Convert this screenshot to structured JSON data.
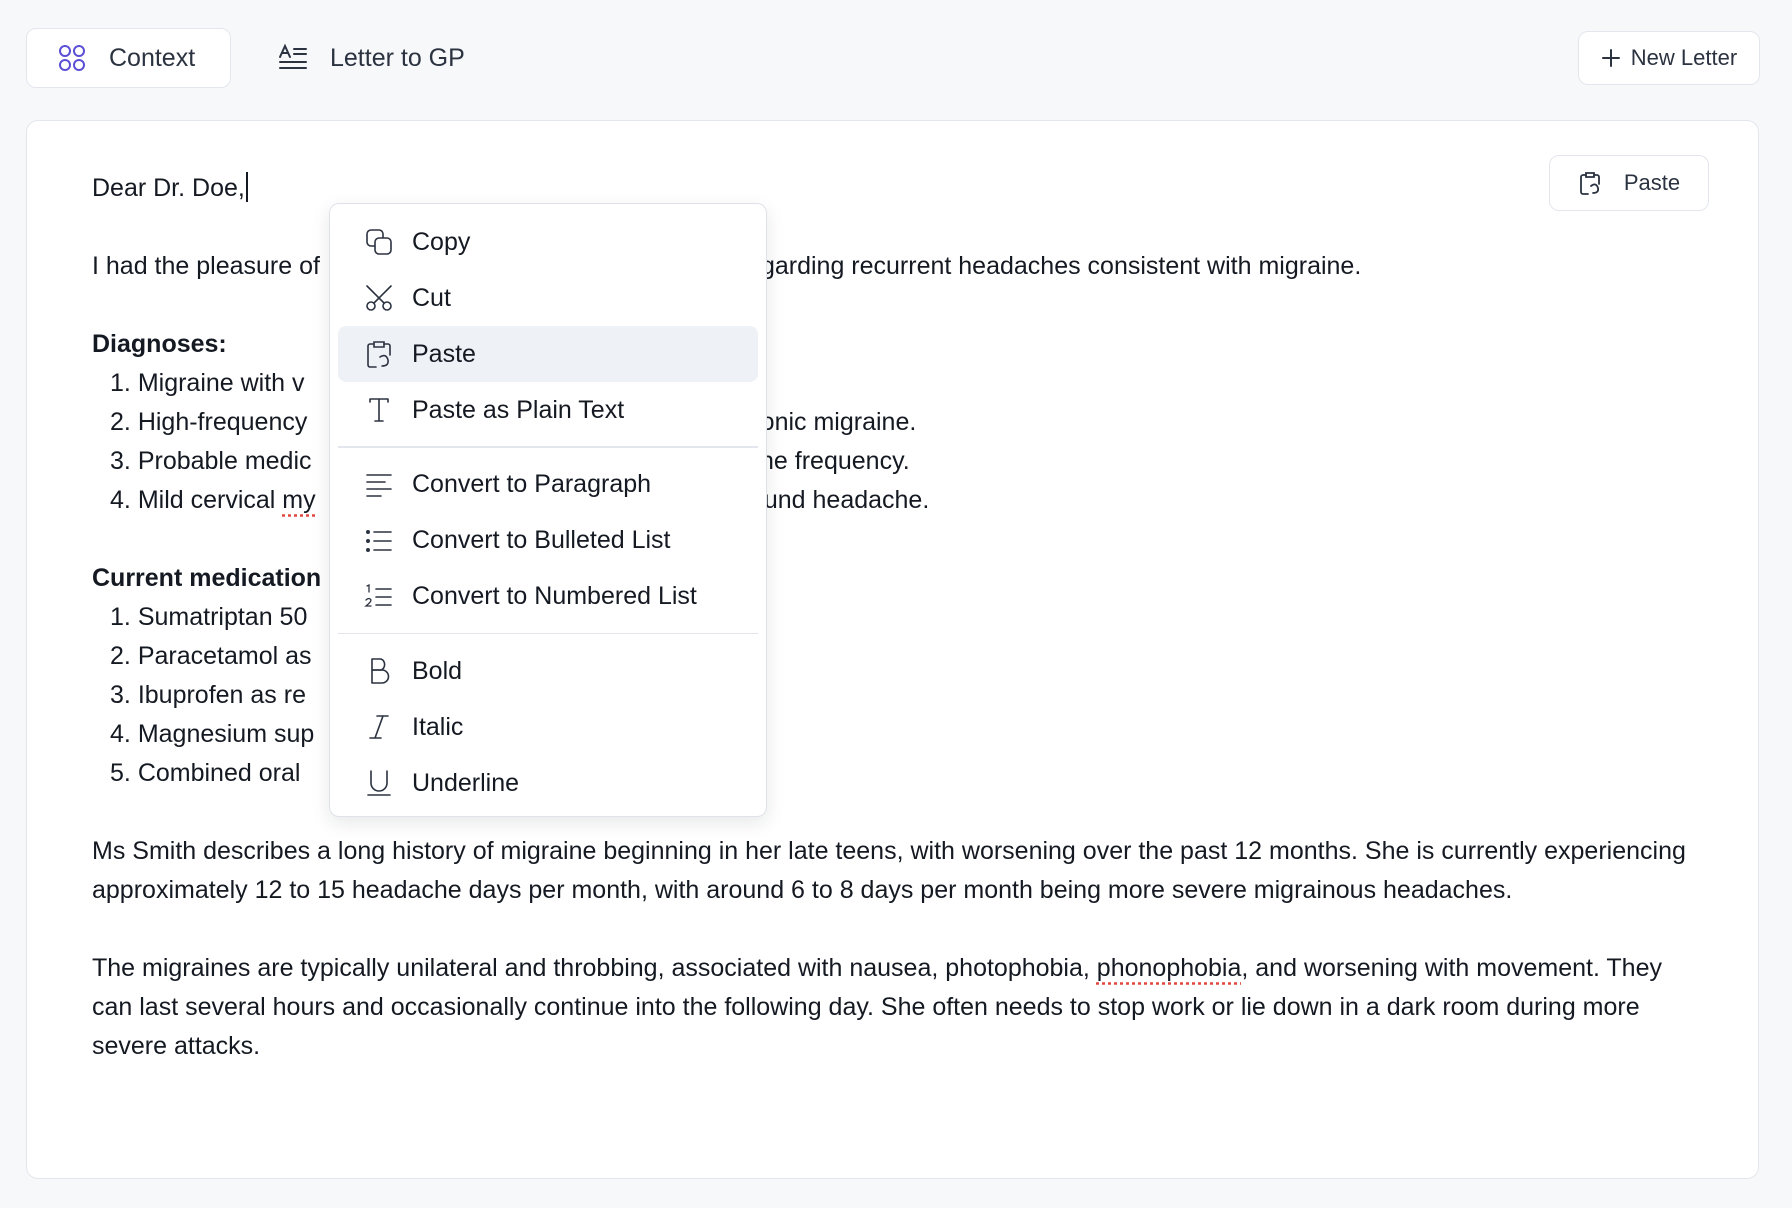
{
  "tabs": [
    {
      "label": "Context",
      "icon": "grid-icon",
      "active": true
    },
    {
      "label": "Letter to GP",
      "icon": "text-align-icon",
      "active": false
    }
  ],
  "new_letter": {
    "label": "New Letter",
    "icon": "plus-icon"
  },
  "paste_button": {
    "label": "Paste",
    "icon": "clipboard-icon"
  },
  "letter": {
    "greeting": "Dear Dr. Doe,",
    "intro": "I had the pleasure of",
    "intro_tail": "garding recurrent headaches consistent with migraine.",
    "diagnoses_heading": "Diagnoses:",
    "diagnoses": [
      {
        "num": "1.",
        "text": "Migraine with v",
        "tail": ""
      },
      {
        "num": "2.",
        "text": "High-frequency",
        "tail": "ronic migraine."
      },
      {
        "num": "3.",
        "text": "Probable medic",
        "tail": "che frequency."
      },
      {
        "num": "4.",
        "text": "Mild cervical ",
        "squiggle": "my",
        "tail": "round headache."
      }
    ],
    "medications_heading": "Current medication",
    "medications": [
      {
        "num": "1.",
        "text": "Sumatriptan 50"
      },
      {
        "num": "2.",
        "text": "Paracetamol as"
      },
      {
        "num": "3.",
        "text": "Ibuprofen as re"
      },
      {
        "num": "4.",
        "text": "Magnesium sup"
      },
      {
        "num": "5.",
        "text": "Combined oral"
      }
    ],
    "para1": "Ms Smith describes a long history of migraine beginning in her late teens, with worsening over the past 12 months. She is currently experiencing approximately 12 to 15 headache days per month, with around 6 to 8 days per month being more severe migrainous headaches.",
    "para2_a": "The migraines are typically unilateral and throbbing, associated with nausea, photophobia, ",
    "para2_squiggle": "phonophobia",
    "para2_b": ", and worsening with movement. They can last several hours and occasionally continue into the following day. She often needs to stop work or lie down in a dark room during more severe attacks."
  },
  "context_menu": {
    "highlighted": "Paste",
    "groups": [
      [
        {
          "label": "Copy",
          "icon": "copy-icon"
        },
        {
          "label": "Cut",
          "icon": "scissors-icon"
        },
        {
          "label": "Paste",
          "icon": "clipboard-icon"
        },
        {
          "label": "Paste as Plain Text",
          "icon": "text-type-icon"
        }
      ],
      [
        {
          "label": "Convert to Paragraph",
          "icon": "paragraph-icon"
        },
        {
          "label": "Convert to Bulleted List",
          "icon": "bulleted-list-icon"
        },
        {
          "label": "Convert to Numbered List",
          "icon": "numbered-list-icon"
        }
      ],
      [
        {
          "label": "Bold",
          "icon": "bold-icon"
        },
        {
          "label": "Italic",
          "icon": "italic-icon"
        },
        {
          "label": "Underline",
          "icon": "underline-icon"
        }
      ]
    ]
  }
}
